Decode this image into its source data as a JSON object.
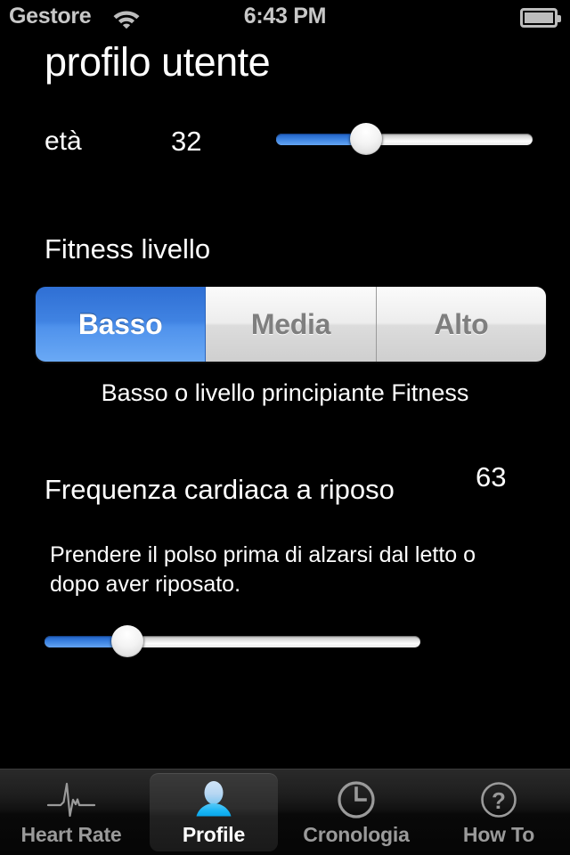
{
  "status_bar": {
    "carrier": "Gestore",
    "time": "6:43 PM",
    "wifi_icon": "wifi-icon",
    "battery_icon": "battery-icon"
  },
  "header": {
    "title": "profilo utente"
  },
  "age": {
    "label": "età",
    "value": "32",
    "slider_percent": 35,
    "min": 1,
    "max": 100
  },
  "fitness": {
    "label": "Fitness livello",
    "options": [
      {
        "label": "Basso",
        "selected": true
      },
      {
        "label": "Media",
        "selected": false
      },
      {
        "label": "Alto",
        "selected": false
      }
    ],
    "selected_value": "Basso",
    "help": "Basso o livello principiante Fitness"
  },
  "resting_heart_rate": {
    "label": "Frequenza cardiaca a riposo",
    "value": "63",
    "help": "Prendere il polso prima di alzarsi dal letto o dopo aver riposato.",
    "slider_percent": 22
  },
  "tab_bar": {
    "tabs": [
      {
        "label": "Heart Rate",
        "icon": "ecg-waveform-icon",
        "selected": false
      },
      {
        "label": "Profile",
        "icon": "person-icon",
        "selected": true
      },
      {
        "label": "Cronologia",
        "icon": "clock-icon",
        "selected": false
      },
      {
        "label": "How To",
        "icon": "question-circle-icon",
        "selected": false
      }
    ]
  },
  "colors": {
    "background": "#000000",
    "accent_blue": "#4083e2",
    "tab_selected_icon": "#3fc3f7",
    "inactive_gray": "#9a9a9a",
    "status_gray": "#c8c8c8"
  }
}
